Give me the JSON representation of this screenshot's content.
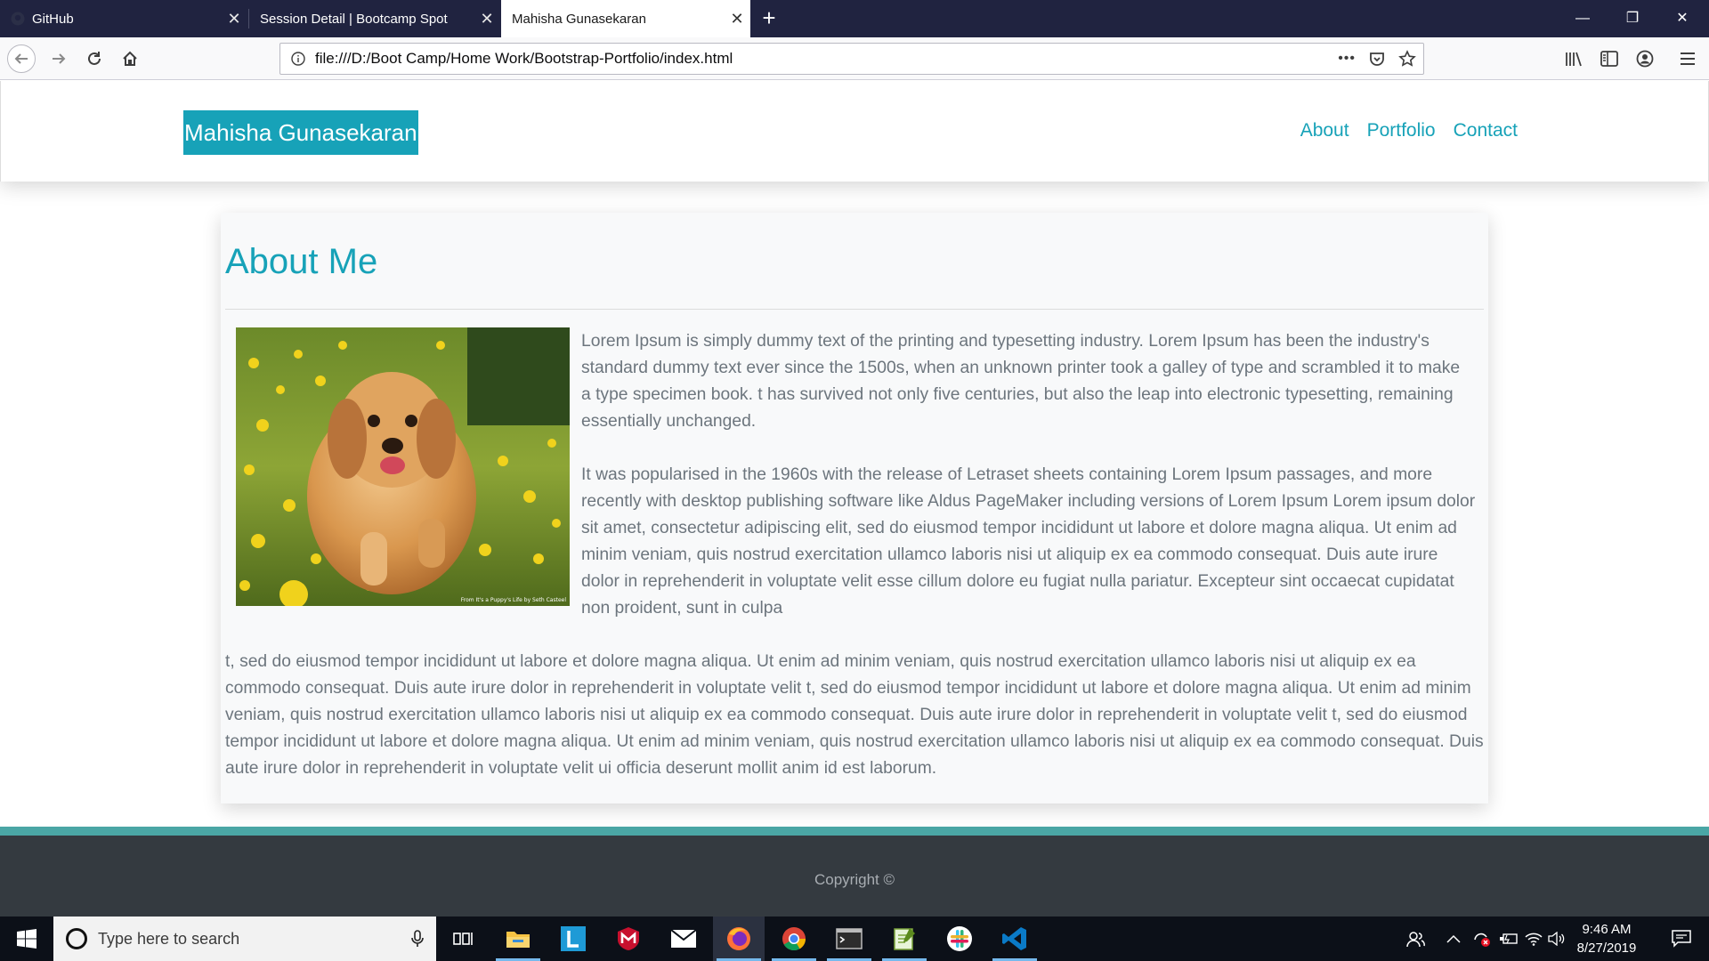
{
  "browser": {
    "tabs": [
      {
        "label": "GitHub",
        "close": "✕"
      },
      {
        "label": "Session Detail | Bootcamp Spot",
        "close": "✕"
      },
      {
        "label": "Mahisha Gunasekaran",
        "close": "✕"
      }
    ],
    "new_tab": "+",
    "url": "file:///D:/Boot Camp/Home Work/Bootstrap-Portfolio/index.html",
    "url_more": "•••",
    "window_controls": {
      "minimize": "—",
      "restore": "❐",
      "close": "✕"
    }
  },
  "site": {
    "brand": "Mahisha Gunasekaran",
    "nav": [
      "About",
      "Portfolio",
      "Contact"
    ],
    "about": {
      "heading": "About Me",
      "photo_credit": "From It's a Puppy's Life by Seth Casteel",
      "paragraph_1": "Lorem Ipsum is simply dummy text of the printing and typesetting industry. Lorem Ipsum has been the industry's standard dummy text ever since the 1500s, when an unknown printer took a galley of type and scrambled it to make a type specimen book. t has survived not only five centuries, but also the leap into electronic typesetting, remaining essentially unchanged.",
      "paragraph_2": "It was popularised in the 1960s with the release of Letraset sheets containing Lorem Ipsum passages, and more recently with desktop publishing software like Aldus PageMaker including versions of Lorem Ipsum Lorem ipsum dolor sit amet, consectetur adipiscing elit, sed do eiusmod tempor incididunt ut labore et dolore magna aliqua. Ut enim ad minim veniam, quis nostrud exercitation ullamco laboris nisi ut aliquip ex ea commodo consequat. Duis aute irure dolor in reprehenderit in voluptate velit esse cillum dolore eu fugiat nulla pariatur. Excepteur sint occaecat cupidatat non proident, sunt in culpa",
      "paragraph_3": "t, sed do eiusmod tempor incididunt ut labore et dolore magna aliqua. Ut enim ad minim veniam, quis nostrud exercitation ullamco laboris nisi ut aliquip ex ea commodo consequat. Duis aute irure dolor in reprehenderit in voluptate velit t, sed do eiusmod tempor incididunt ut labore et dolore magna aliqua. Ut enim ad minim veniam, quis nostrud exercitation ullamco laboris nisi ut aliquip ex ea commodo consequat. Duis aute irure dolor in reprehenderit in voluptate velit t, sed do eiusmod tempor incididunt ut labore et dolore magna aliqua. Ut enim ad minim veniam, quis nostrud exercitation ullamco laboris nisi ut aliquip ex ea commodo consequat. Duis aute irure dolor in reprehenderit in voluptate velit ui officia deserunt mollit anim id est laborum."
    },
    "footer": "Copyright ©"
  },
  "taskbar": {
    "search_placeholder": "Type here to search",
    "time": "9:46 AM",
    "date": "8/27/2019",
    "apps": [
      "task-view",
      "file-explorer",
      "l-app",
      "mcafee",
      "mail",
      "firefox",
      "chrome",
      "terminal",
      "editor",
      "slack",
      "vscode"
    ]
  },
  "colors": {
    "accent": "#17a2b8",
    "tabbar": "#202340",
    "footer": "#343a40",
    "footer_border": "#4aa6a5",
    "body_text": "#6c757d"
  }
}
